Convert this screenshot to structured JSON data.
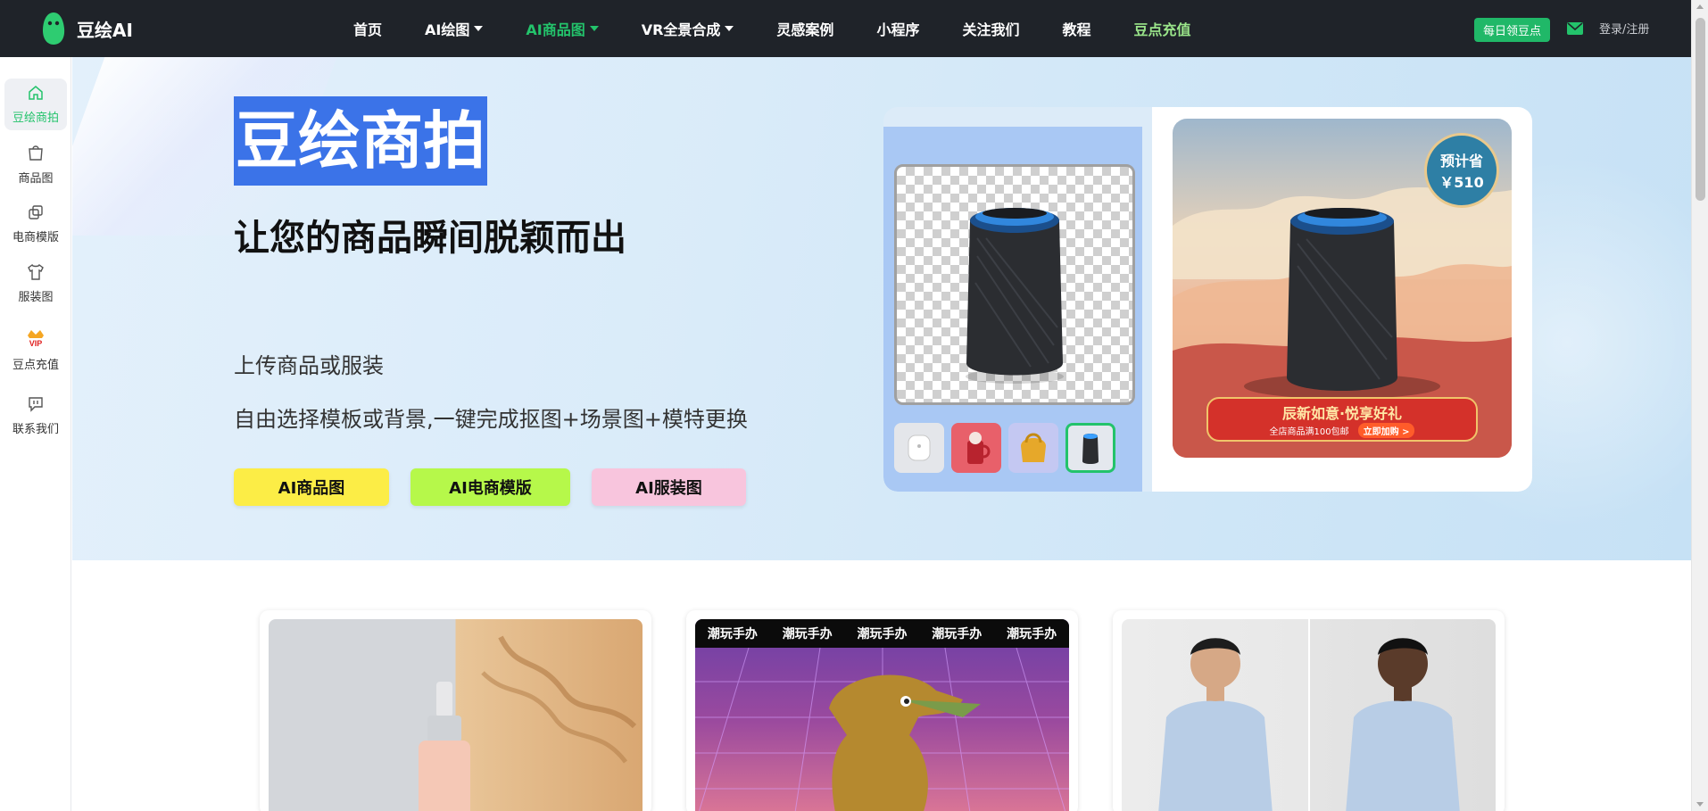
{
  "app": {
    "name": "豆绘AI"
  },
  "nav": {
    "items": [
      {
        "label": "首页",
        "dropdown": false,
        "state": "normal"
      },
      {
        "label": "AI绘图",
        "dropdown": true,
        "state": "normal"
      },
      {
        "label": "AI商品图",
        "dropdown": true,
        "state": "active"
      },
      {
        "label": "VR全景合成",
        "dropdown": true,
        "state": "normal"
      },
      {
        "label": "灵感案例",
        "dropdown": false,
        "state": "normal"
      },
      {
        "label": "小程序",
        "dropdown": false,
        "state": "normal"
      },
      {
        "label": "关注我们",
        "dropdown": false,
        "state": "normal"
      },
      {
        "label": "教程",
        "dropdown": false,
        "state": "normal"
      },
      {
        "label": "豆点充值",
        "dropdown": false,
        "state": "recharge"
      }
    ],
    "daily_points_label": "每日领豆点",
    "login_label": "登录/注册"
  },
  "sidebar": {
    "items": [
      {
        "label": "豆绘商拍",
        "icon": "home-icon",
        "active": true
      },
      {
        "label": "商品图",
        "icon": "bag-icon",
        "active": false
      },
      {
        "label": "电商模版",
        "icon": "copy-icon",
        "active": false
      },
      {
        "label": "服装图",
        "icon": "shirt-icon",
        "active": false
      },
      {
        "label": "豆点充值",
        "icon": "vip-crown-icon",
        "active": false
      },
      {
        "label": "联系我们",
        "icon": "chat-icon",
        "active": false
      }
    ]
  },
  "hero": {
    "title": "豆绘商拍",
    "subtitle": "让您的商品瞬间脱颖而出",
    "desc1": "上传商品或服装",
    "desc2": "自由选择模板或背景,一键完成抠图+场景图+模特更换",
    "buttons": [
      "AI商品图",
      "AI电商模版",
      "AI服装图"
    ]
  },
  "showcase": {
    "thumbnails": [
      "earbuds",
      "red-cup",
      "yellow-bag",
      "speaker"
    ],
    "selected_thumbnail": "speaker",
    "badge_line1": "预计省",
    "badge_line2": "￥510",
    "banner_title": "辰新如意·悦享好礼",
    "banner_sub": "全店商品满100包邮",
    "banner_buy": "立即加购 >"
  },
  "cards": {
    "trend_label": "潮玩手办"
  },
  "colors": {
    "nav_bg": "#1f2329",
    "accent_green": "#23c36b",
    "title_highlight": "#3b73e8",
    "cta_yellow": "#fced46",
    "cta_green": "#b6f84a",
    "cta_pink": "#f8c5dd"
  }
}
